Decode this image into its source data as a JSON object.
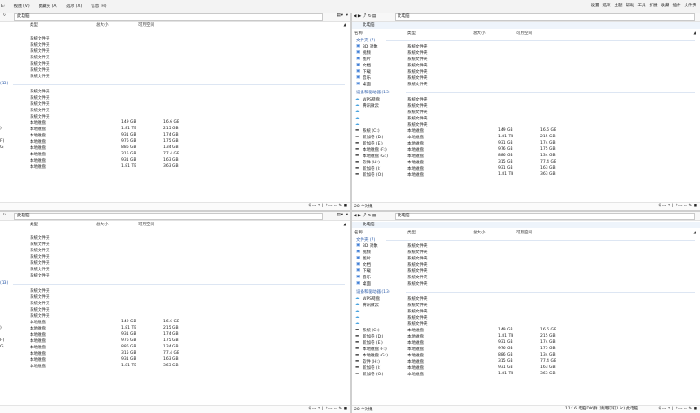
{
  "menubar": {
    "menus": [
      "E)",
      "视图 (V)",
      "收藏夹 (A)",
      "选项 (X)",
      "信息 (H)"
    ],
    "right_items": [
      "设置",
      "选项",
      "主题",
      "帮助",
      "工具",
      "扩展",
      "收藏",
      "插件",
      "文件夹"
    ]
  },
  "path_label": "此电脑",
  "nav_path_label": "此电脑",
  "headers": {
    "name": "名称",
    "type": "类型",
    "total": "总大小",
    "free": "可用空间"
  },
  "groups": {
    "folders": "文件夹 (7)",
    "devices": "设备和驱动器 (13)",
    "devices_cut": "(13)"
  },
  "folders": [
    {
      "name": "3D 对象",
      "type": "系统文件夹"
    },
    {
      "name": "视频",
      "type": "系统文件夹"
    },
    {
      "name": "图片",
      "type": "系统文件夹"
    },
    {
      "name": "文档",
      "type": "系统文件夹"
    },
    {
      "name": "下载",
      "type": "系统文件夹"
    },
    {
      "name": "音乐",
      "type": "系统文件夹"
    },
    {
      "name": "桌面",
      "type": "系统文件夹"
    }
  ],
  "devices": [
    {
      "name": "WPS网盘",
      "type": "系统文件夹",
      "total": "",
      "free": "",
      "cut": ""
    },
    {
      "name": "腾讯微云",
      "type": "系统文件夹",
      "total": "",
      "free": "",
      "cut": ""
    },
    {
      "name": "",
      "type": "系统文件夹",
      "total": "",
      "free": "",
      "cut": ""
    },
    {
      "name": "",
      "type": "系统文件夹",
      "total": "",
      "free": "",
      "cut": ""
    },
    {
      "name": "",
      "type": "系统文件夹",
      "total": "",
      "free": "",
      "cut": ""
    },
    {
      "name": "系统 (C:)",
      "type": "本地磁盘",
      "total": "149 GB",
      "free": "16.6 GB",
      "cut": ""
    },
    {
      "name": "新加卷 (D:)",
      "type": "本地磁盘",
      "total": "1.81 TB",
      "free": "215 GB",
      "cut": ")"
    },
    {
      "name": "新加卷 (E:)",
      "type": "本地磁盘",
      "total": "931 GB",
      "free": "174 GB",
      "cut": ""
    },
    {
      "name": "本地磁盘 (F:)",
      "type": "本地磁盘",
      "total": "976 GB",
      "free": "175 GB",
      "cut": "F)"
    },
    {
      "name": "本地磁盘 (G:)",
      "type": "本地磁盘",
      "total": "886 GB",
      "free": "134 GB",
      "cut": "G)"
    },
    {
      "name": "软件 (H:)",
      "type": "本地磁盘",
      "total": "315 GB",
      "free": "77.4 GB",
      "cut": ""
    },
    {
      "name": "新加卷 (I:)",
      "type": "本地磁盘",
      "total": "931 GB",
      "free": "163 GB",
      "cut": ""
    },
    {
      "name": "新加卷 (O:)",
      "type": "本地磁盘",
      "total": "1.81 TB",
      "free": "363 GB",
      "cut": ""
    }
  ],
  "status": {
    "items_tr": "20 个对象",
    "items_br": "20 个对象"
  },
  "taskbar": {
    "time": "11:16",
    "text": "电脑DIY群 (请用钉钉/Lic)",
    "label": "此电脑"
  }
}
